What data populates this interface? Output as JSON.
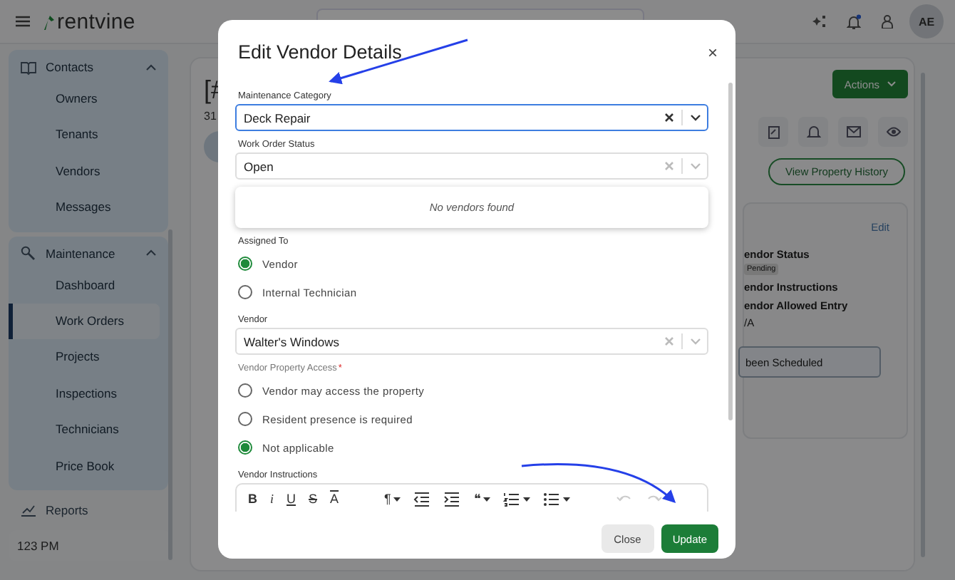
{
  "header": {
    "logo": "rentvine",
    "avatar": "AE"
  },
  "sidebar": {
    "groups": [
      {
        "label": "Contacts",
        "expanded": true,
        "items": [
          {
            "label": "Owners",
            "selected": false
          },
          {
            "label": "Tenants",
            "selected": false
          },
          {
            "label": "Vendors",
            "selected": false
          },
          {
            "label": "Messages",
            "selected": false
          }
        ]
      },
      {
        "label": "Maintenance",
        "expanded": true,
        "items": [
          {
            "label": "Dashboard",
            "selected": false
          },
          {
            "label": "Work Orders",
            "selected": true
          },
          {
            "label": "Projects",
            "selected": false
          },
          {
            "label": "Inspections",
            "selected": false
          },
          {
            "label": "Technicians",
            "selected": false
          },
          {
            "label": "Price Book",
            "selected": false
          }
        ]
      }
    ],
    "links": [
      {
        "label": "Reports"
      }
    ],
    "footer": "123 PM"
  },
  "page": {
    "title": "[#",
    "subtitle": "31",
    "actions_button": "Actions",
    "history_button": "View Property History",
    "card": {
      "edit": "Edit",
      "fields": [
        {
          "label": "endor Status",
          "badge": "Pending"
        },
        {
          "label": "endor Instructions"
        },
        {
          "label": "endor Allowed Entry",
          "value": "/A"
        }
      ],
      "notice": "been Scheduled"
    }
  },
  "modal": {
    "title": "Edit Vendor Details",
    "close": "×",
    "fields": [
      {
        "kind": "select",
        "label": "Maintenance Category",
        "value": "Deck Repair",
        "focused": true
      },
      {
        "kind": "select",
        "label": "Work Order Status",
        "value": "Open",
        "focused": false
      },
      {
        "kind": "menu",
        "message": "No vendors found"
      },
      {
        "kind": "radio",
        "label": "Assigned To",
        "options": [
          {
            "label": "Vendor",
            "selected": true
          },
          {
            "label": "Internal Technician",
            "selected": false
          }
        ]
      },
      {
        "kind": "select",
        "label": "Vendor",
        "value": "Walter's Windows",
        "focused": false
      },
      {
        "kind": "radio",
        "label": "Vendor Property Access",
        "required_mark": "*",
        "options": [
          {
            "label": "Vendor may access the property",
            "selected": false
          },
          {
            "label": "Resident presence is required",
            "selected": false
          },
          {
            "label": "Not applicable",
            "selected": true
          }
        ]
      },
      {
        "kind": "editor",
        "label": "Vendor Instructions",
        "toolbar": [
          {
            "kind": "bold",
            "label": "B"
          },
          {
            "kind": "italic",
            "label": "i"
          },
          {
            "kind": "underline",
            "label": "U"
          },
          {
            "kind": "strike",
            "label": "S"
          },
          {
            "kind": "clear",
            "label": "A"
          },
          {
            "kind": "gap"
          },
          {
            "kind": "paragraph",
            "label": "¶"
          },
          {
            "kind": "outdent"
          },
          {
            "kind": "indent"
          },
          {
            "kind": "quote",
            "label": "❝"
          },
          {
            "kind": "numbered"
          },
          {
            "kind": "bullets"
          },
          {
            "kind": "gap"
          },
          {
            "kind": "undo"
          },
          {
            "kind": "redo"
          }
        ]
      }
    ],
    "buttons": [
      {
        "label": "Close",
        "primary": false
      },
      {
        "label": "Update",
        "primary": true
      }
    ]
  },
  "annotations": [
    {
      "kind": "straight"
    },
    {
      "kind": "curved"
    }
  ]
}
